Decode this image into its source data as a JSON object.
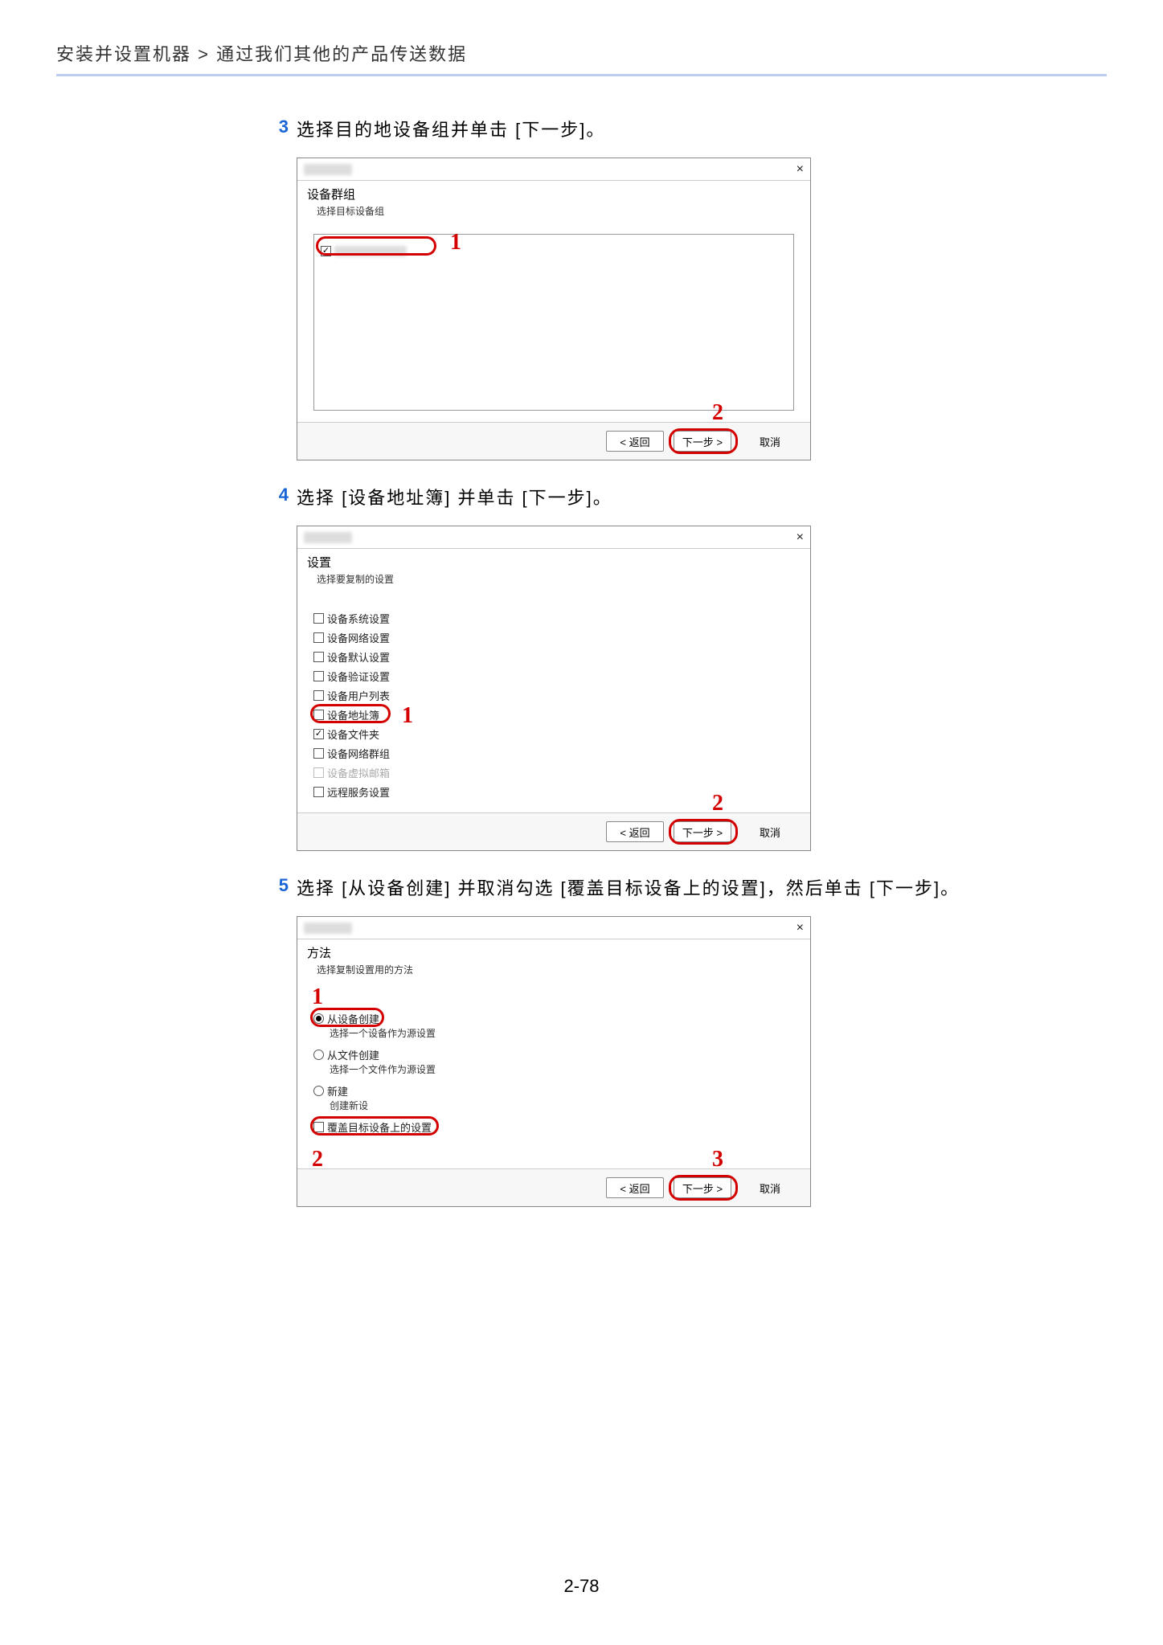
{
  "breadcrumb": "安装并设置机器 > 通过我们其他的产品传送数据",
  "page_number": "2-78",
  "steps": {
    "s3": {
      "num": "3",
      "text": "选择目的地设备组并单击 [下一步]。"
    },
    "s4": {
      "num": "4",
      "text": "选择 [设备地址簿] 并单击 [下一步]。"
    },
    "s5": {
      "num": "5",
      "text": "选择 [从设备创建] 并取消勾选 [覆盖目标设备上的设置]，然后单击 [下一步]。"
    }
  },
  "dialog1": {
    "title": "设备群组",
    "subtitle": "选择目标设备组",
    "back": "< 返回",
    "next": "下一步 >",
    "cancel": "取消",
    "callout1": "1",
    "callout2": "2"
  },
  "dialog2": {
    "title": "设置",
    "subtitle": "选择要复制的设置",
    "items": {
      "i1": "设备系统设置",
      "i2": "设备网络设置",
      "i3": "设备默认设置",
      "i4": "设备验证设置",
      "i5": "设备用户列表",
      "i6": "设备地址簿",
      "i7": "设备文件夹",
      "i8": "设备网络群组",
      "i9": "设备虚拟邮箱",
      "i10": "远程服务设置"
    },
    "back": "< 返回",
    "next": "下一步 >",
    "cancel": "取消",
    "callout1": "1",
    "callout2": "2"
  },
  "dialog3": {
    "title": "方法",
    "subtitle": "选择复制设置用的方法",
    "opt1": "从设备创建",
    "opt1_sub": "选择一个设备作为源设置",
    "opt2": "从文件创建",
    "opt2_sub": "选择一个文件作为源设置",
    "opt3": "新建",
    "opt3_sub": "创建新设",
    "overwrite": "覆盖目标设备上的设置",
    "back": "< 返回",
    "next": "下一步 >",
    "cancel": "取消",
    "callout1": "1",
    "callout2": "2",
    "callout3": "3"
  }
}
